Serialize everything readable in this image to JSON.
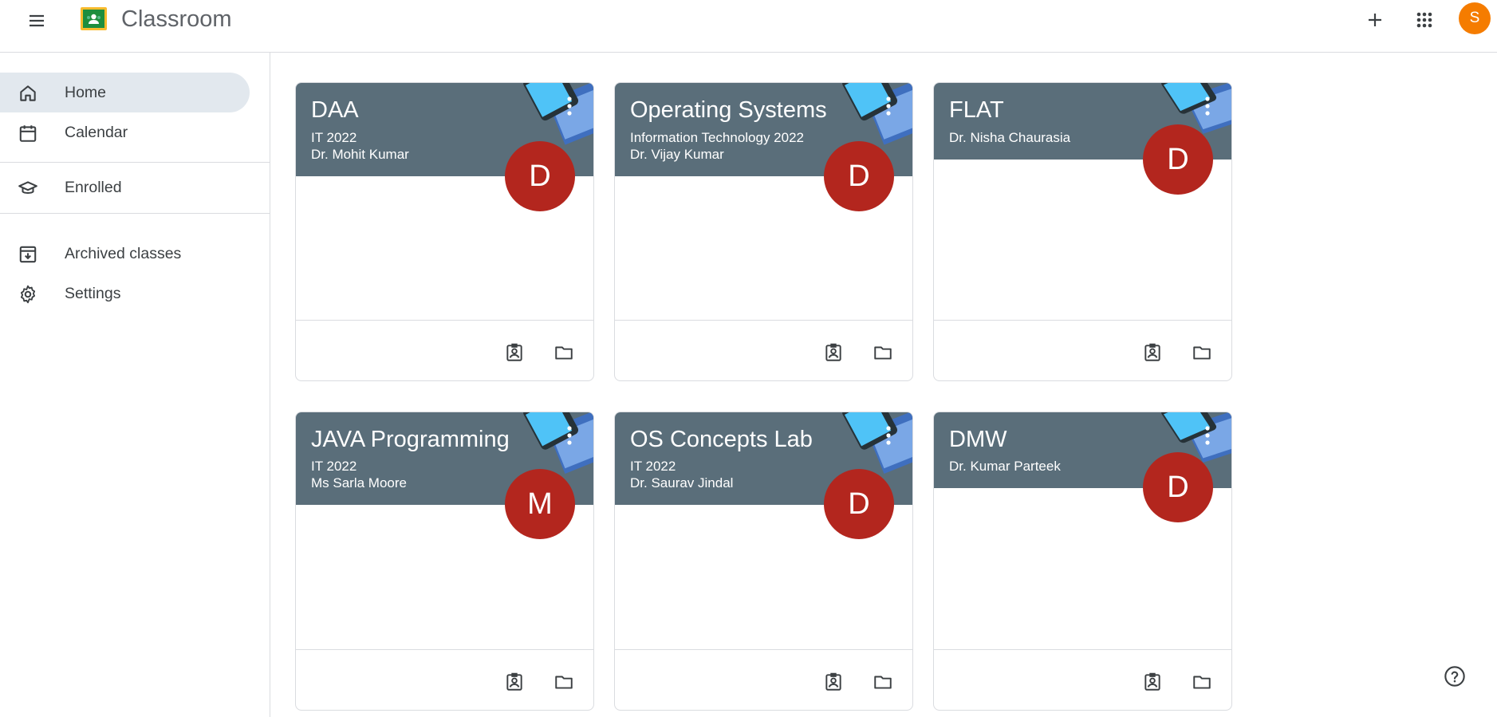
{
  "header": {
    "app_title": "Classroom",
    "menu_icon": "hamburger-menu-icon",
    "add_icon": "plus-icon",
    "apps_icon": "apps-grid-icon",
    "account_initial": "S",
    "account_color": "#f57c00"
  },
  "sidebar": {
    "items": [
      {
        "label": "Home",
        "icon": "home-icon",
        "active": true
      },
      {
        "label": "Calendar",
        "icon": "calendar-icon"
      },
      {
        "label": "Enrolled",
        "icon": "enrolled-icon"
      },
      {
        "label": "Archived classes",
        "icon": "archive-icon"
      },
      {
        "label": "Settings",
        "icon": "gear-icon"
      }
    ]
  },
  "classes": [
    {
      "title": "DAA",
      "line1": "IT 2022",
      "line2": "Dr. Mohit Kumar",
      "initial": "D"
    },
    {
      "title": "Operating Systems",
      "line1": "Information Technology 2022",
      "line2": "Dr. Vijay Kumar",
      "initial": "D"
    },
    {
      "title": "FLAT",
      "line1": "Dr. Nisha Chaurasia",
      "line2": "",
      "initial": "D"
    },
    {
      "title": "JAVA Programming",
      "line1": "IT 2022",
      "line2": "Ms Sarla Moore",
      "initial": "M"
    },
    {
      "title": "OS Concepts Lab",
      "line1": "IT 2022",
      "line2": "Dr. Saurav Jindal",
      "initial": "D"
    },
    {
      "title": "DMW",
      "line1": "Dr. Kumar Parteek",
      "line2": "",
      "initial": "D"
    }
  ],
  "colors": {
    "banner": "#5a6e7a",
    "initial_circle": "#b3261e",
    "active_nav": "#e2e8ee"
  },
  "help_icon": "help-circle-icon"
}
